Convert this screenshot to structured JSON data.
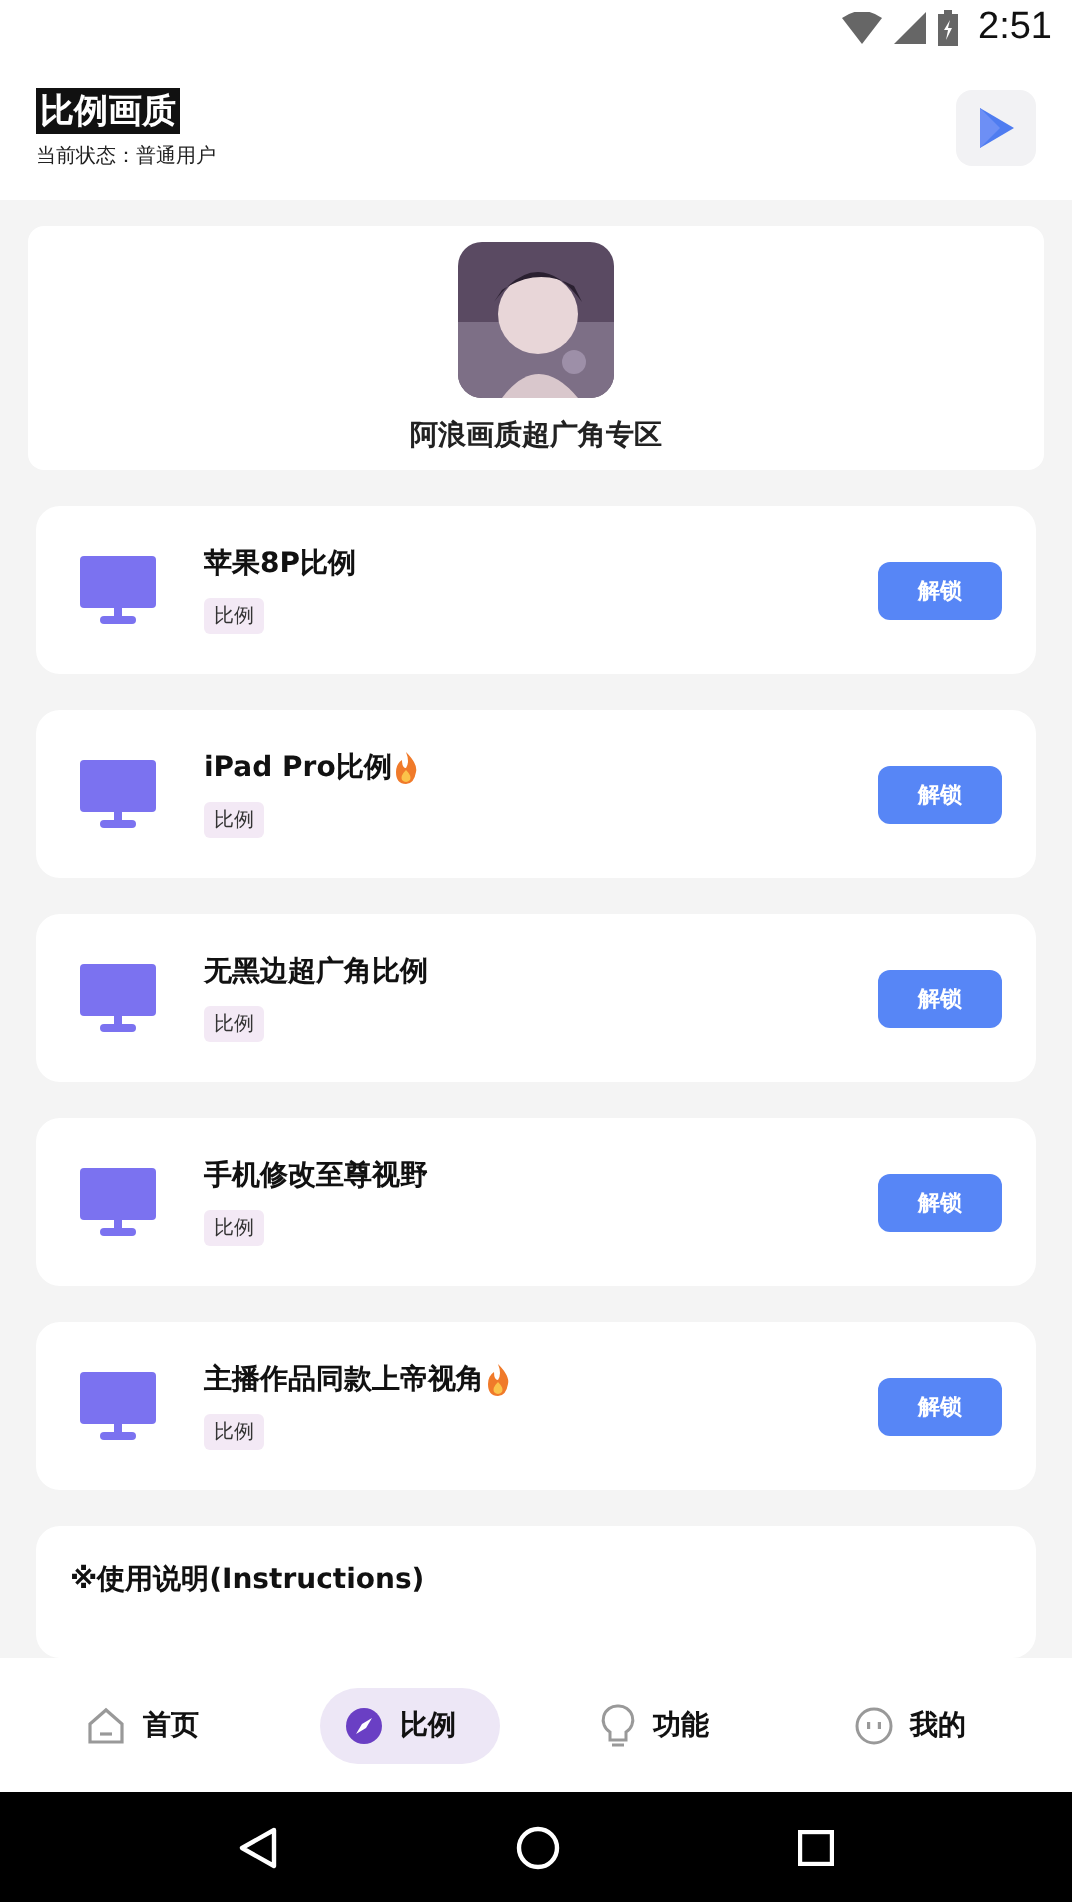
{
  "status_bar": {
    "time": "2:51"
  },
  "header": {
    "title": "比例画质",
    "subtitle": "当前状态：普通用户"
  },
  "banner": {
    "title": "阿浪画质超广角专区"
  },
  "items": [
    {
      "title": "苹果8P比例",
      "hot": false,
      "tag": "比例",
      "button": "解锁"
    },
    {
      "title": "iPad Pro比例",
      "hot": true,
      "tag": "比例",
      "button": "解锁"
    },
    {
      "title": "无黑边超广角比例",
      "hot": false,
      "tag": "比例",
      "button": "解锁"
    },
    {
      "title": "手机修改至尊视野",
      "hot": false,
      "tag": "比例",
      "button": "解锁"
    },
    {
      "title": "主播作品同款上帝视角",
      "hot": true,
      "tag": "比例",
      "button": "解锁"
    }
  ],
  "instructions": {
    "title": "※使用说明(Instructions)"
  },
  "bottom_nav": [
    {
      "kind": "home",
      "label": "首页",
      "selected": false
    },
    {
      "kind": "compass",
      "label": "比例",
      "selected": true
    },
    {
      "kind": "bulb",
      "label": "功能",
      "selected": false
    },
    {
      "kind": "face",
      "label": "我的",
      "selected": false
    }
  ]
}
